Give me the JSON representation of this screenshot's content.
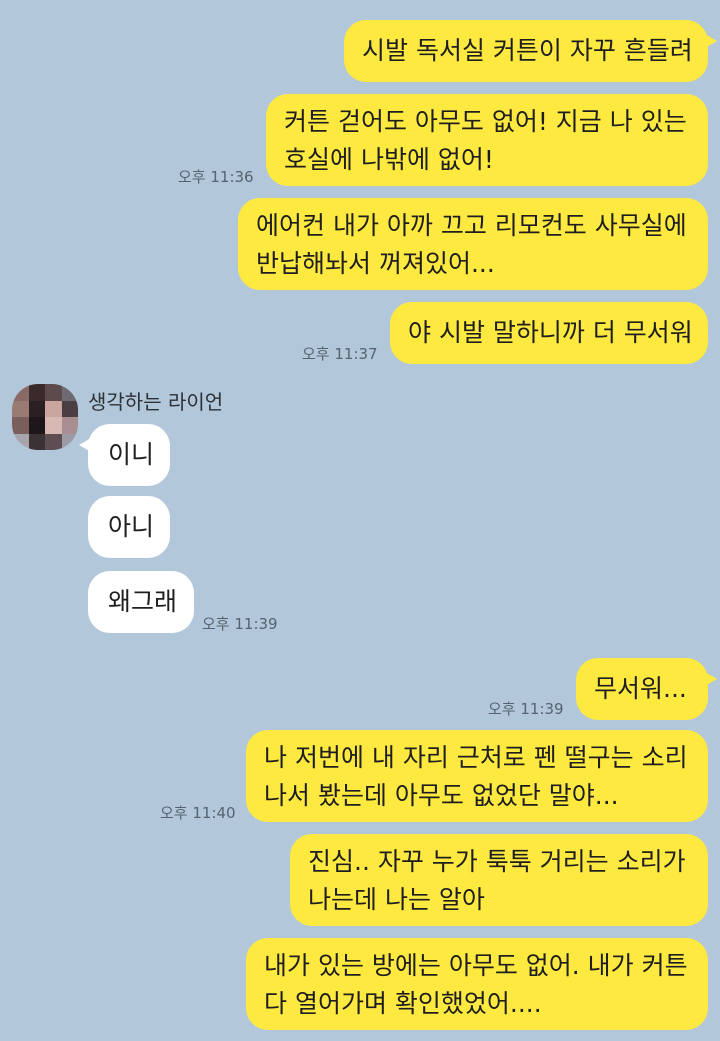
{
  "chat": {
    "sender_name": "생각하는 라이언",
    "colors": {
      "background": "#b2c7da",
      "my_bubble": "#fee941",
      "their_bubble": "#ffffff"
    },
    "messages": [
      {
        "from": "me",
        "lines": [
          "시발 독서실 커튼이 자꾸 흔들려"
        ]
      },
      {
        "from": "me",
        "lines": [
          "커튼 걷어도 아무도 없어! 지금 나 있는",
          "호실에 나밖에 없어!"
        ],
        "time": "오후 11:36"
      },
      {
        "from": "me",
        "lines": [
          "에어컨 내가 아까 끄고 리모컨도 사무실에",
          "반납해놔서 꺼져있어..."
        ]
      },
      {
        "from": "me",
        "lines": [
          "야 시발 말하니까 더 무서워"
        ],
        "time": "오후 11:37"
      },
      {
        "from": "them",
        "lines": [
          "이니"
        ]
      },
      {
        "from": "them",
        "lines": [
          "아니"
        ]
      },
      {
        "from": "them",
        "lines": [
          "왜그래"
        ],
        "time": "오후 11:39"
      },
      {
        "from": "me",
        "lines": [
          "무서워..."
        ],
        "time": "오후 11:39"
      },
      {
        "from": "me",
        "lines": [
          "나 저번에 내 자리 근처로 펜 떨구는 소리",
          "나서 봤는데 아무도 없었단 말야..."
        ],
        "time": "오후 11:40"
      },
      {
        "from": "me",
        "lines": [
          "진심.. 자꾸 누가 툭툭 거리는 소리가",
          "나는데 나는 알아"
        ]
      },
      {
        "from": "me",
        "lines": [
          "내가 있는 방에는 아무도 없어. 내가 커튼",
          "다 열어가며 확인했었어...."
        ]
      }
    ]
  }
}
